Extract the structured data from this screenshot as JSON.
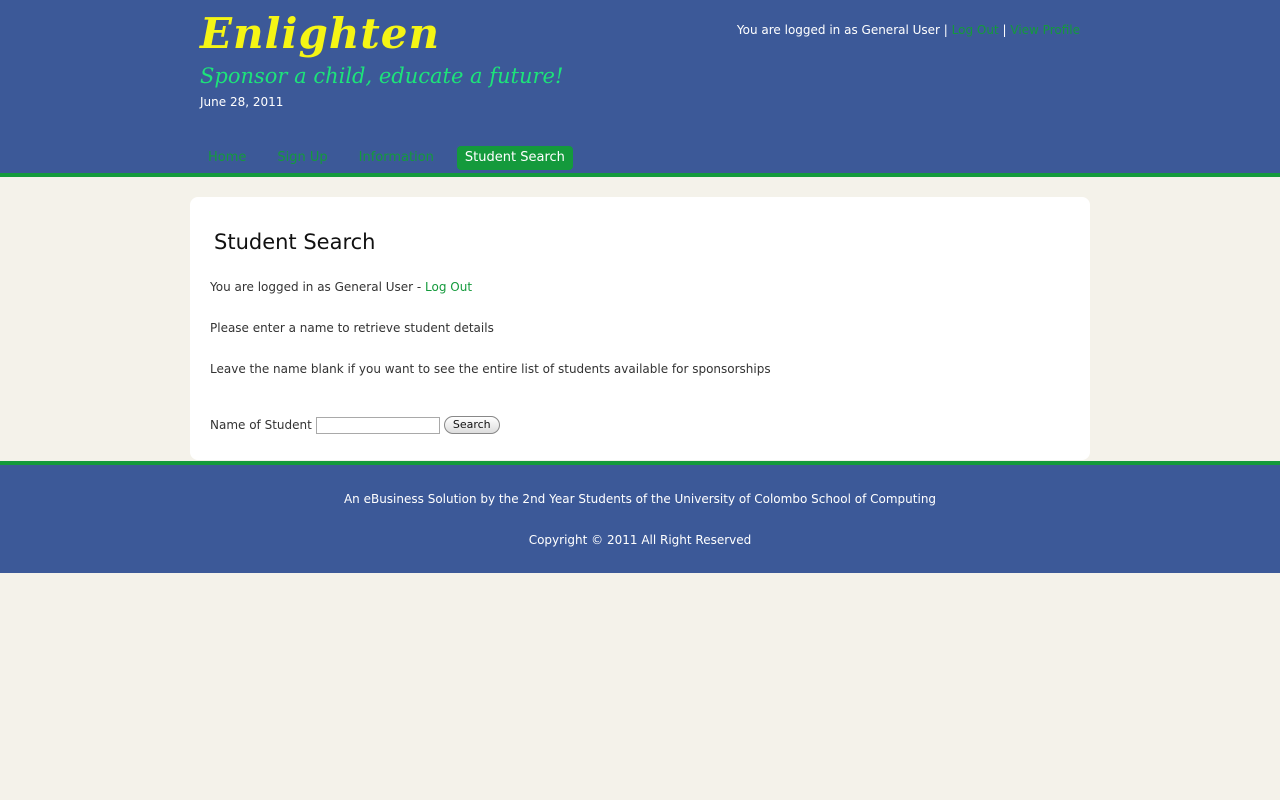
{
  "header": {
    "site_title": "Enlighten",
    "tagline": "Sponsor a child, educate a future!",
    "date": "June 28, 2011",
    "logged_in_text": "You are logged in as General User |",
    "logout_link": "Log Out",
    "separator": "|",
    "view_profile_link": "View Profile"
  },
  "nav": {
    "items": [
      {
        "label": "Home"
      },
      {
        "label": "Sign Up"
      },
      {
        "label": "Information"
      },
      {
        "label": "Student Search"
      }
    ]
  },
  "main": {
    "title": "Student Search",
    "logged_in_text": "You are logged in as General User -",
    "logout_link": "Log Out",
    "instruction1": "Please enter a name to retrieve student details",
    "instruction2": "Leave the name blank if you want to see the entire list of students available for sponsorships",
    "field_label": "Name of Student",
    "field_value": "",
    "search_button": "Search"
  },
  "footer": {
    "line1": "An eBusiness Solution by the 2nd Year Students of the University of Colombo School of Computing",
    "line2": "Copyright © 2011 All Right Reserved"
  },
  "colors": {
    "header_bg": "#3c5998",
    "accent_green": "#149a3c",
    "title_yellow": "#f5f515",
    "tagline_green": "#1de37a",
    "page_bg": "#f4f2ea"
  }
}
